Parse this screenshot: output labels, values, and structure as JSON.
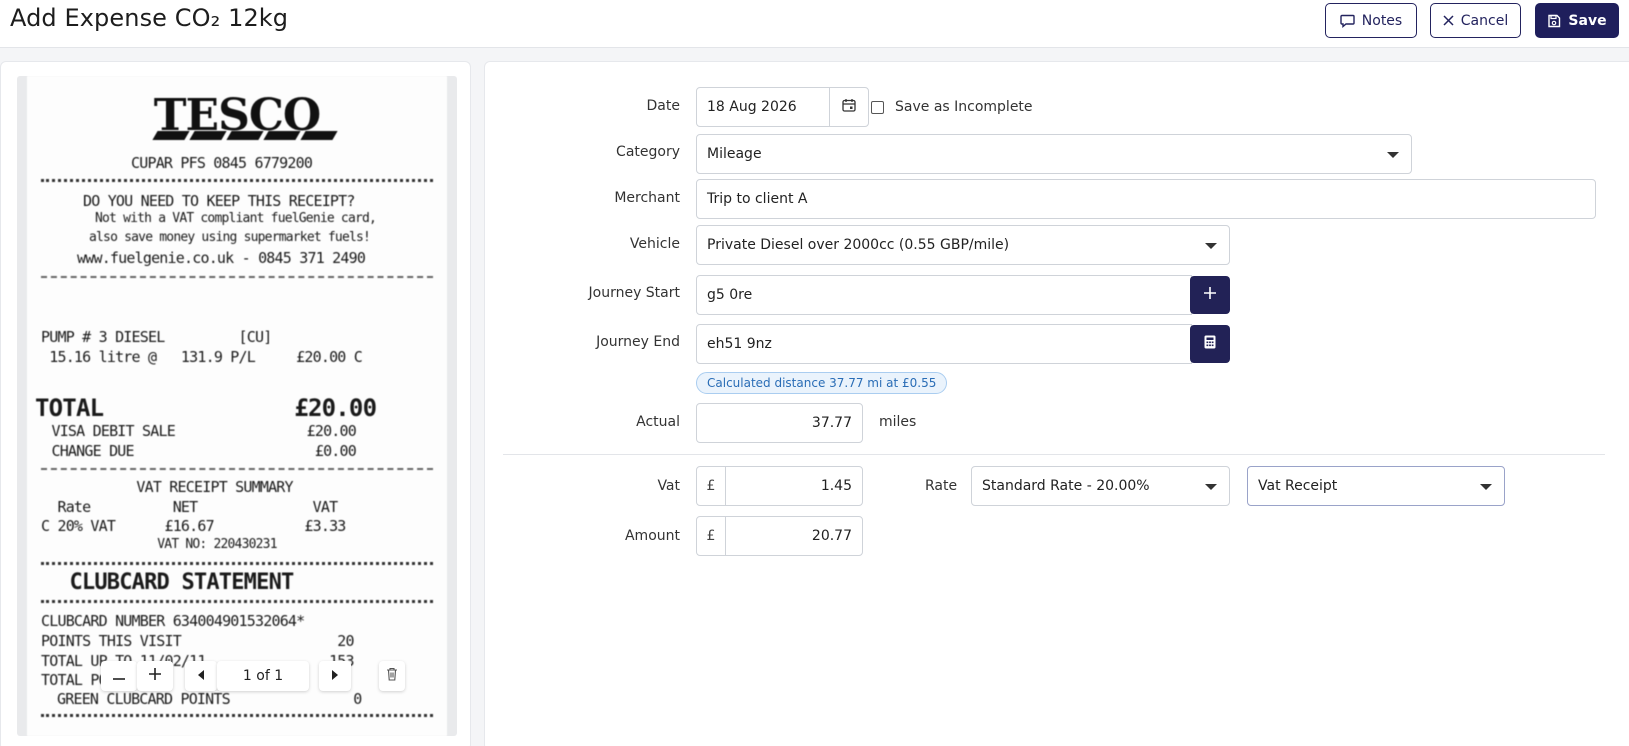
{
  "header": {
    "title": "Add Expense CO₂ 12kg",
    "notes_label": "Notes",
    "cancel_label": "Cancel",
    "save_label": "Save"
  },
  "receipt": {
    "store": "TESCO",
    "lines": [
      "CUPAR PFS 0845 6779200",
      "DO YOU NEED TO KEEP THIS RECEIPT?",
      "Not with a VAT compliant fuelGenie card,",
      "also save money using supermarket fuels!",
      "www.fuelgenie.co.uk - 0845 371 2490",
      "PUMP # 3 DIESEL         [CU]",
      " 15.16 litre @   131.9 P/L     £20.00 C",
      "TOTAL              £20.00",
      "  VISA DEBIT SALE                £20.00",
      "  CHANGE DUE                      £0.00",
      "      VAT RECEIPT SUMMARY",
      "  Rate          NET              VAT",
      "C 20% VAT      £16.67           £3.33",
      "          VAT NO: 220430231",
      " CLUBCARD STATEMENT",
      "CLUBCARD NUMBER 634004901532064*",
      "POINTS THIS VISIT                   20",
      "TOTAL UP TO 11/02/11               153",
      "TOTAL POINTS",
      "GREEN CLUBCARD POINTS               0"
    ],
    "pager_text": "1 of 1"
  },
  "form": {
    "date": {
      "label": "Date",
      "value": "18 Aug 2026"
    },
    "save_incomplete_label": "Save as Incomplete",
    "category": {
      "label": "Category",
      "value": "Mileage"
    },
    "merchant": {
      "label": "Merchant",
      "value": "Trip to client A"
    },
    "vehicle": {
      "label": "Vehicle",
      "value": "Private Diesel over 2000cc (0.55 GBP/mile)"
    },
    "journey_start": {
      "label": "Journey Start",
      "value": "g5 0re"
    },
    "journey_end": {
      "label": "Journey End",
      "value": "eh51 9nz"
    },
    "distance_badge": "Calculated distance 37.77 mi at £0.55",
    "actual": {
      "label": "Actual",
      "value": "37.77",
      "unit": "miles"
    },
    "vat": {
      "label": "Vat",
      "currency": "£",
      "value": "1.45"
    },
    "rate": {
      "label": "Rate",
      "value": "Standard Rate - 20.00%"
    },
    "vat_type": {
      "value": "Vat Receipt"
    },
    "amount": {
      "label": "Amount",
      "currency": "£",
      "value": "20.77"
    }
  },
  "colors": {
    "primary": "#1f1f5c",
    "badge_bg": "#eaf3fc",
    "badge_text": "#2a6db6"
  },
  "icons": [
    "comment-icon",
    "close-icon",
    "save-icon",
    "calendar-icon",
    "plus-icon",
    "calculator-icon",
    "minus-icon",
    "caret-left-icon",
    "caret-right-icon",
    "trash-icon",
    "chevron-down-icon"
  ]
}
